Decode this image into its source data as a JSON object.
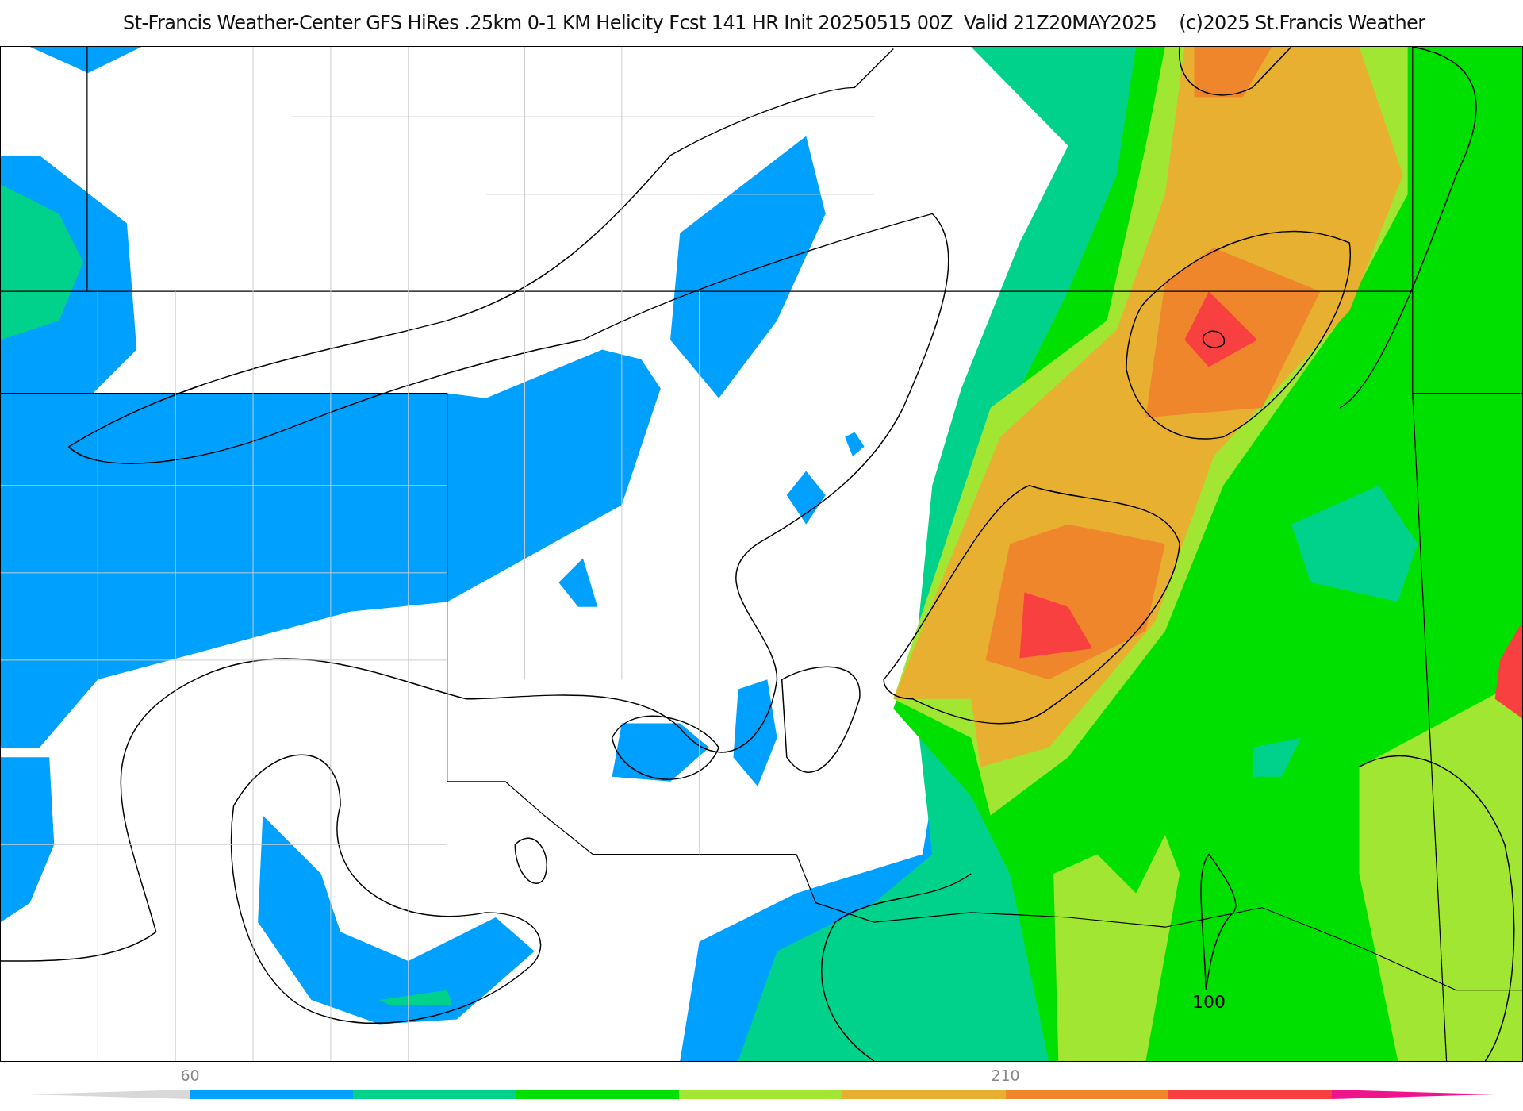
{
  "title": "St-Francis Weather-Center GFS HiRes .25km 0-1 KM Helicity Fcst 141 HR Init 20250515 00Z  Valid 21Z20MAY2025    (c)2025 St.Francis Weather",
  "map": {
    "contour_label": "100"
  },
  "colorbar": [
    {
      "kind": "open-end",
      "color": "#d8d8d8"
    },
    {
      "kind": "segment",
      "color": "#00a0ff",
      "label": "60"
    },
    {
      "kind": "segment",
      "color": "#00d28c"
    },
    {
      "kind": "segment",
      "color": "#00e000"
    },
    {
      "kind": "segment",
      "color": "#a0e632"
    },
    {
      "kind": "segment",
      "color": "#e8b030"
    },
    {
      "kind": "segment",
      "color": "#f0862c",
      "label": "210"
    },
    {
      "kind": "segment",
      "color": "#f84040"
    },
    {
      "kind": "end",
      "color": "#f0148c"
    }
  ]
}
